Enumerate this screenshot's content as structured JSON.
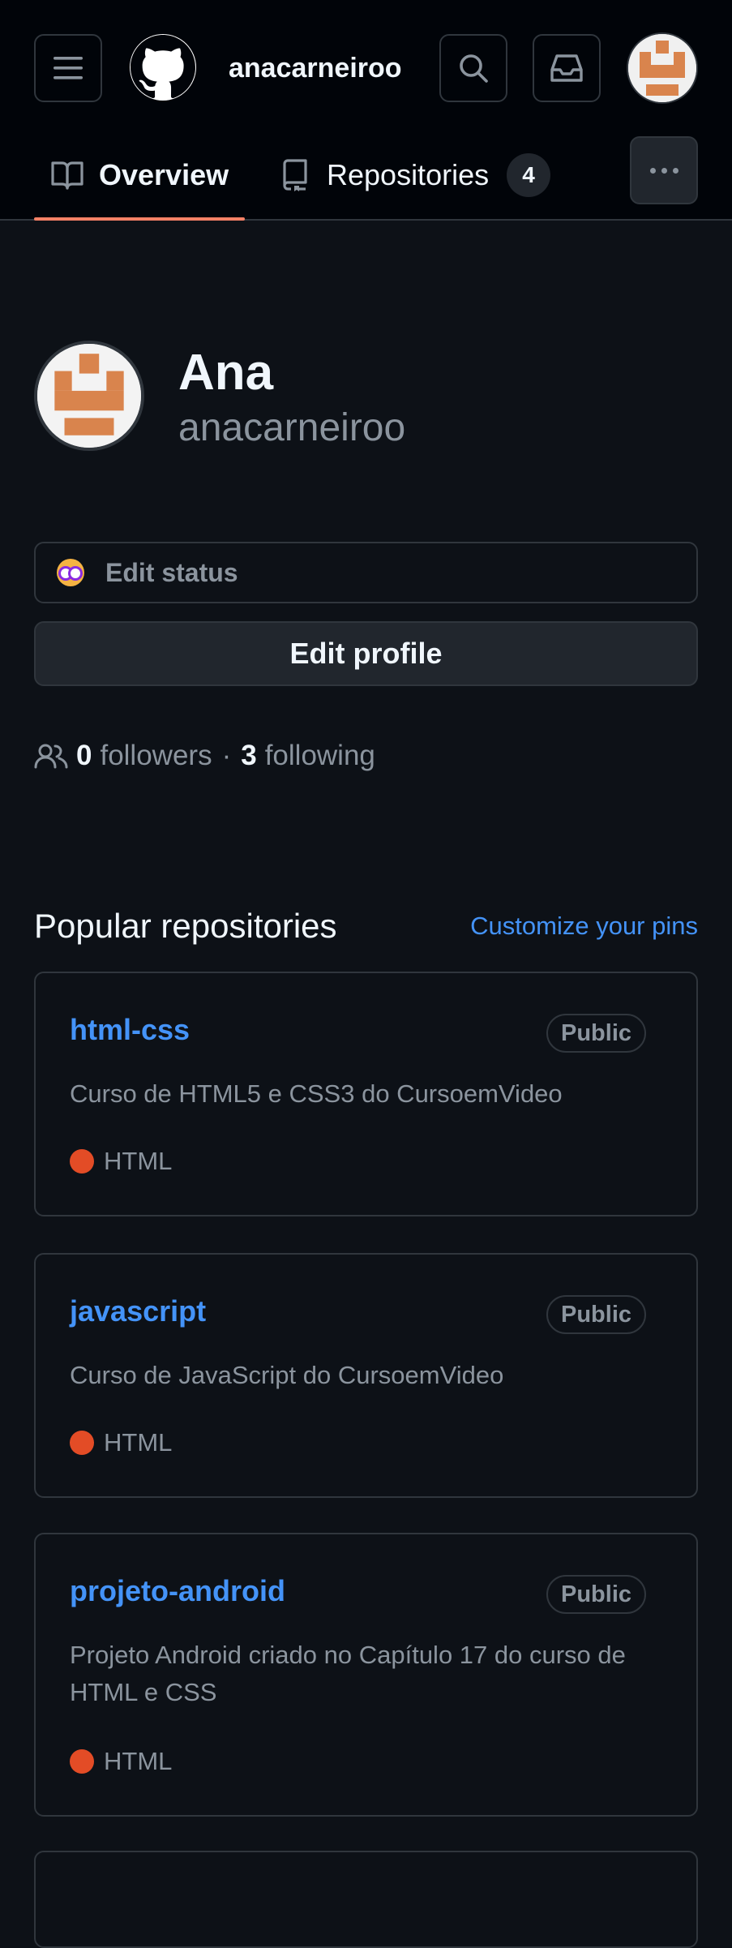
{
  "header": {
    "username": "anacarneiroo",
    "menu_icon": "hamburger-menu-icon",
    "logo_icon": "github-logo-icon",
    "search_icon": "search-icon",
    "inbox_icon": "inbox-icon"
  },
  "tabs": {
    "overview": "Overview",
    "repositories": "Repositories",
    "repositories_count": "4"
  },
  "profile": {
    "name": "Ana",
    "login": "anacarneiroo",
    "edit_status": "Edit status",
    "edit_profile": "Edit profile",
    "followers_count": "0",
    "followers_label": "followers",
    "separator": "·",
    "following_count": "3",
    "following_label": "following"
  },
  "popular": {
    "title": "Popular repositories",
    "customize": "Customize your pins",
    "repos": [
      {
        "name": "html-css",
        "visibility": "Public",
        "description": "Curso de HTML5 e CSS3 do CursoemVideo",
        "language": "HTML",
        "language_color": "#e34c26"
      },
      {
        "name": "javascript",
        "visibility": "Public",
        "description": "Curso de JavaScript do CursoemVideo",
        "language": "HTML",
        "language_color": "#e34c26"
      },
      {
        "name": "projeto-android",
        "visibility": "Public",
        "description": "Projeto Android criado no Capítulo 17 do curso de HTML e CSS",
        "language": "HTML",
        "language_color": "#e34c26"
      }
    ]
  },
  "colors": {
    "accent_link": "#4493f8",
    "tab_underline": "#f78166",
    "avatar_color": "#d9844d"
  }
}
